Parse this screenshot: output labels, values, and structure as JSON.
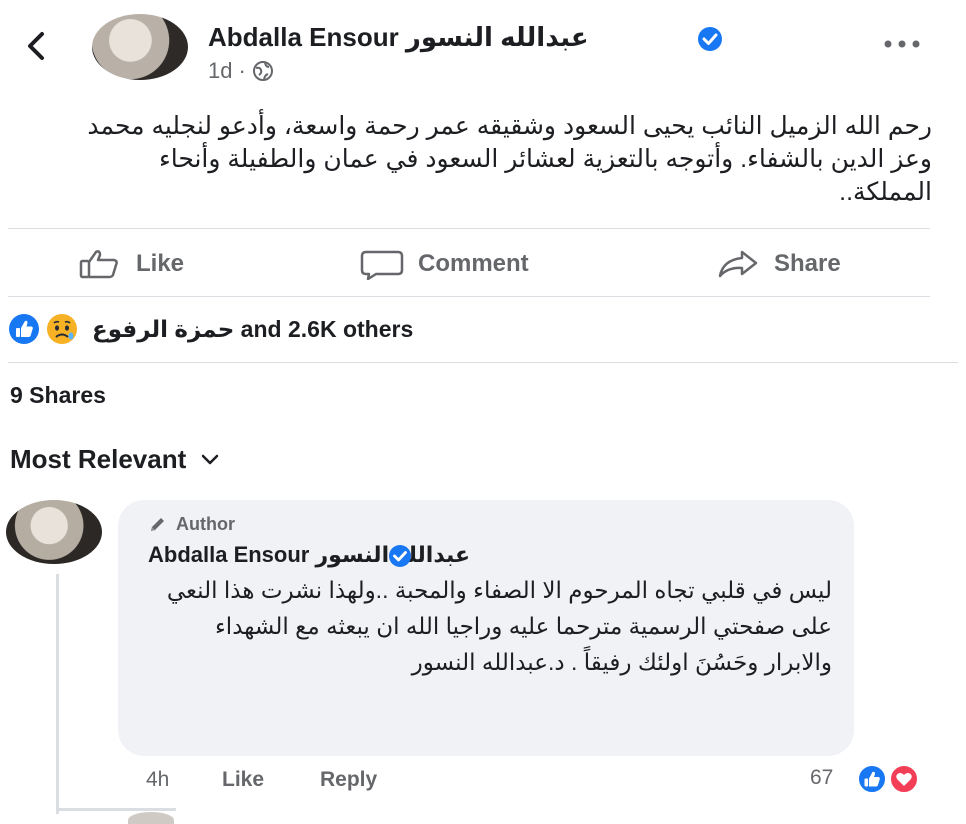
{
  "post": {
    "author_name": "Abdalla Ensour عبدالله  النسور",
    "time": "1d",
    "separator": "·",
    "text": "رحم الله الزميل النائب يحيى السعود وشقيقه عمر رحمة واسعة، وأدعو لنجليه محمد وعز الدين بالشفاء. وأتوجه بالتعزية لعشائر السعود في عمان والطفيلة وأنحاء المملكة..",
    "actions": {
      "like": "Like",
      "comment": "Comment",
      "share": "Share"
    },
    "reactors": "حمزة الرفوع and 2.6K others",
    "shares": "9 Shares",
    "sort_label": "Most Relevant"
  },
  "comment": {
    "badge": "Author",
    "author_name": "Abdalla Ensour عبدالله النسور",
    "text": "ليس في قلبي تجاه المرحوم الا الصفاء والمحبة ..ولهذا نشرت هذا النعي على صفحتي الرسمية مترحما عليه وراجيا الله ان يبعثه مع الشهداء والابرار وحَسُنَ اولئك رفيقاً . د.عبدالله النسور",
    "time": "4h",
    "like": "Like",
    "reply": "Reply",
    "reaction_count": "67"
  },
  "colors": {
    "facebook_blue": "#1877f2",
    "love_red": "#f33e58",
    "muted_text": "#65676b",
    "bubble_bg": "#f0f2f5"
  },
  "icons": [
    "back-arrow-icon",
    "verified-icon",
    "globe-icon",
    "more-icon",
    "like-icon",
    "comment-icon",
    "share-icon",
    "like-reaction-icon",
    "sad-reaction-icon",
    "chevron-down-icon",
    "pencil-icon",
    "love-reaction-icon"
  ]
}
